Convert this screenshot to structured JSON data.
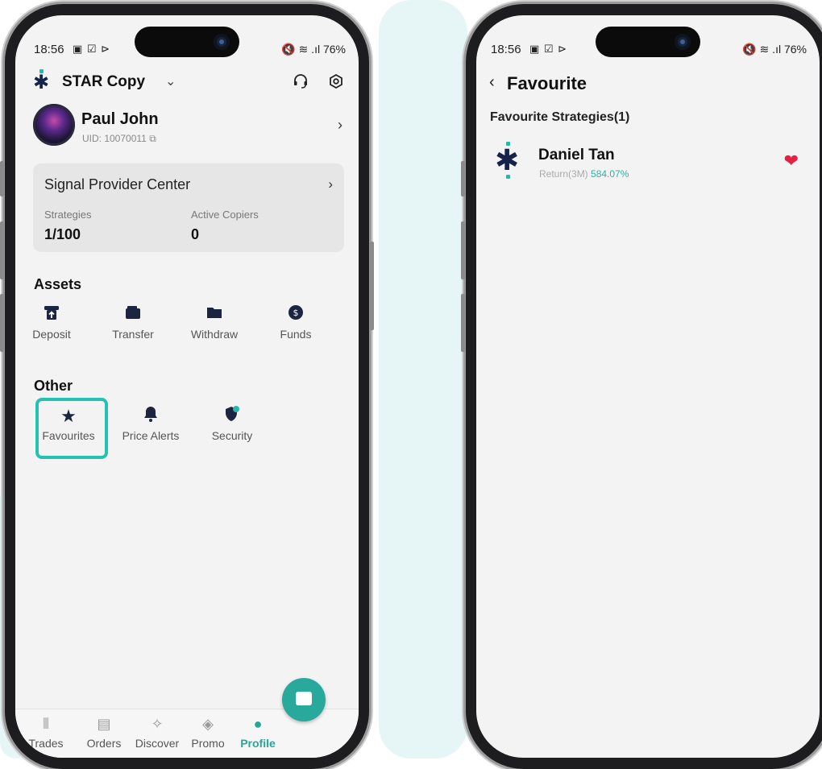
{
  "left_phone": {
    "status": {
      "time": "18:56",
      "icons_left": "▣ ☑ ⊳",
      "icons_right": "🔇 ≋ .ıl",
      "battery": "76%"
    },
    "header": {
      "app_title": "STAR Copy",
      "dropdown_glyph": "⌄",
      "support_icon": "headset-icon",
      "settings_icon": "settings-icon"
    },
    "profile": {
      "name": "Paul John",
      "uid": "UID: 10070011",
      "copy_glyph": "⧉",
      "chevron": "›"
    },
    "signal_provider": {
      "title": "Signal Provider Center",
      "chevron": "›",
      "strategies_label": "Strategies",
      "strategies_value": "1/100",
      "copiers_label": "Active Copiers",
      "copiers_value": "0"
    },
    "assets": {
      "title": "Assets",
      "items": [
        {
          "label": "Deposit",
          "icon": "deposit-icon",
          "glyph": "⬆"
        },
        {
          "label": "Transfer",
          "icon": "wallet-icon",
          "glyph": "▬"
        },
        {
          "label": "Withdraw",
          "icon": "folder-icon",
          "glyph": "▰"
        },
        {
          "label": "Funds",
          "icon": "coin-icon",
          "glyph": "$"
        }
      ]
    },
    "other": {
      "title": "Other",
      "items": [
        {
          "label": "Favourites",
          "icon": "star-icon",
          "glyph": "★"
        },
        {
          "label": "Price Alerts",
          "icon": "bell-icon",
          "glyph": "🔔"
        },
        {
          "label": "Security",
          "icon": "shield-icon",
          "glyph": "⛊"
        }
      ]
    },
    "tabbar": {
      "items": [
        {
          "label": "Trades",
          "icon": "candlestick-icon",
          "glyph": "⫴"
        },
        {
          "label": "Orders",
          "icon": "receipt-icon",
          "glyph": "▤"
        },
        {
          "label": "Discover",
          "icon": "telescope-icon",
          "glyph": "✧"
        },
        {
          "label": "Promo",
          "icon": "promo-icon",
          "glyph": "◈"
        },
        {
          "label": "Profile",
          "icon": "person-icon",
          "glyph": "●"
        }
      ],
      "active": "Profile"
    }
  },
  "right_phone": {
    "status": {
      "time": "18:56",
      "icons_left": "▣ ☑ ⊳",
      "icons_right": "🔇 ≋ .ıl",
      "battery": "76%"
    },
    "page_title": "Favourite",
    "back_glyph": "‹",
    "section_title": "Favourite Strategies(1)",
    "strategies": [
      {
        "name": "Daniel Tan",
        "return_label": "Return(3M)",
        "return_value": "584.07%"
      }
    ]
  },
  "colors": {
    "accent": "#2ab7a9",
    "highlight": "#25c2b2",
    "heart": "#e5213f",
    "brand_navy": "#15224a"
  }
}
